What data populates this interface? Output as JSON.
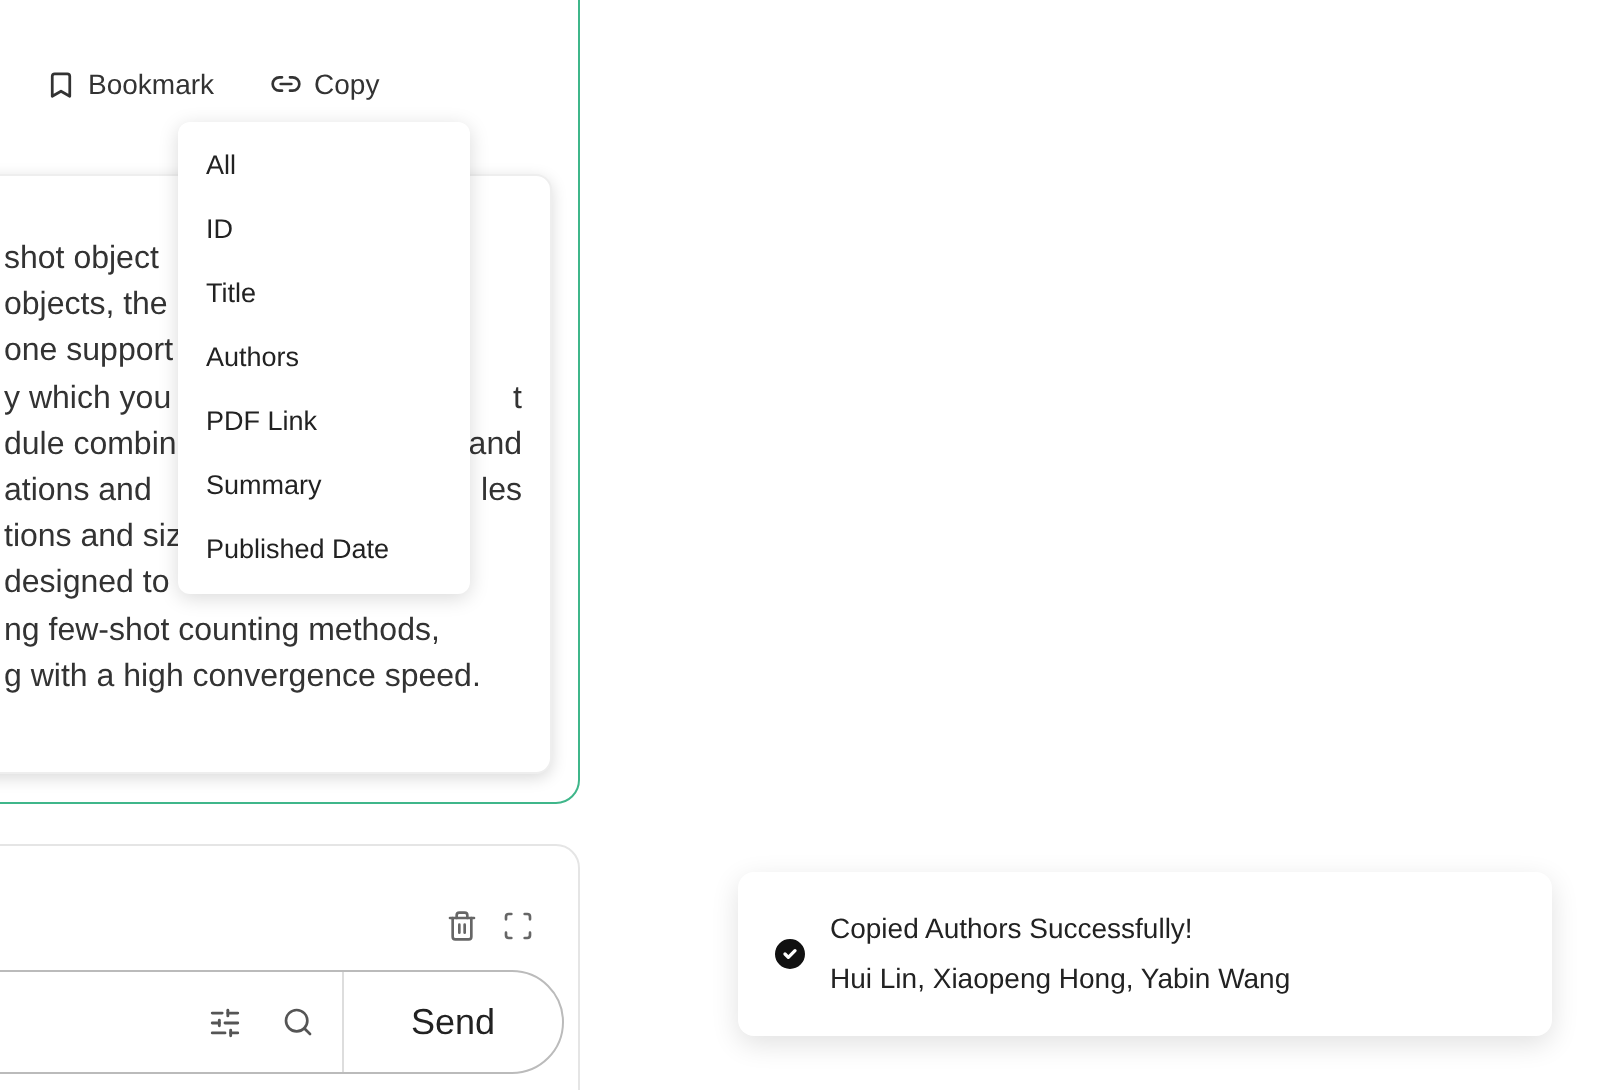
{
  "toolbar": [
    {
      "kind": "bookmark",
      "label": "Bookmark"
    },
    {
      "kind": "copy",
      "label": "Copy"
    }
  ],
  "copy_menu": [
    "All",
    "ID",
    "Title",
    "Authors",
    "PDF Link",
    "Summary",
    "Published Date"
  ],
  "summary_lines": [
    {
      "left": "shot object"
    },
    {
      "left": "objects, the"
    },
    {
      "left": "one support"
    },
    {
      "left": "y which you",
      "right": "t"
    },
    {
      "left": "dule combin",
      "right": "and"
    },
    {
      "left": "ations and",
      "right": "les"
    },
    {
      "left": "tions and siz"
    },
    {
      "left": "designed to"
    },
    {
      "left": "ng few-shot counting methods,"
    },
    {
      "left": "g with a high convergence speed."
    }
  ],
  "chat_input": {
    "send": "Send"
  },
  "toast": {
    "title": "Copied Authors Successfully!",
    "message": "Hui Lin, Xiaopeng Hong, Yabin Wang"
  }
}
